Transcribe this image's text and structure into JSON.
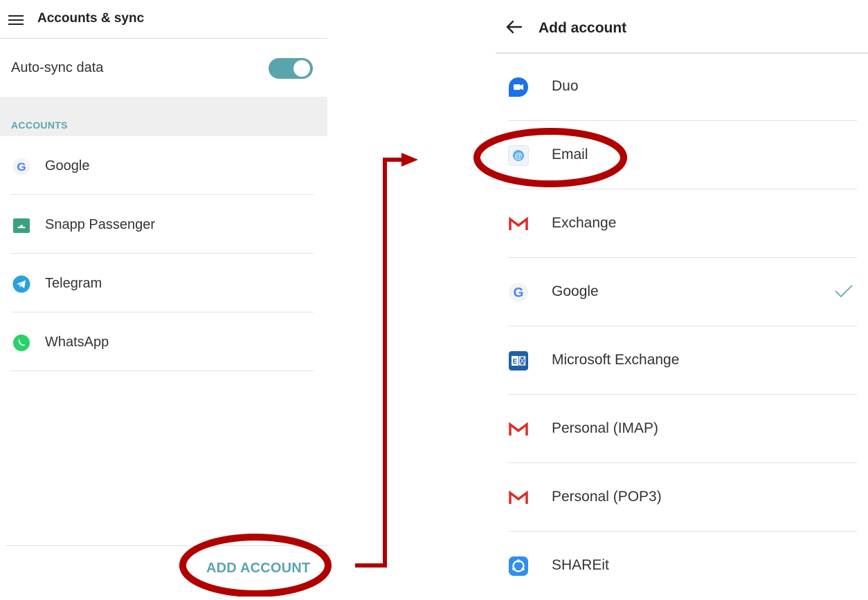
{
  "left_screen": {
    "title": "Accounts & sync",
    "auto_sync": {
      "label": "Auto-sync data",
      "enabled": true
    },
    "section_label": "ACCOUNTS",
    "accounts": [
      {
        "label": "Google",
        "icon": "google-icon"
      },
      {
        "label": "Snapp Passenger",
        "icon": "snapp-icon"
      },
      {
        "label": "Telegram",
        "icon": "telegram-icon"
      },
      {
        "label": "WhatsApp",
        "icon": "whatsapp-icon"
      }
    ],
    "add_account_label": "ADD ACCOUNT"
  },
  "right_screen": {
    "title": "Add account",
    "items": [
      {
        "label": "Duo",
        "icon": "duo-icon",
        "checked": false
      },
      {
        "label": "Email",
        "icon": "email-icon",
        "checked": false,
        "highlighted": true
      },
      {
        "label": "Exchange",
        "icon": "gmail-icon",
        "checked": false
      },
      {
        "label": "Google",
        "icon": "google-icon",
        "checked": true
      },
      {
        "label": "Microsoft Exchange",
        "icon": "outlook-exchange-icon",
        "checked": false
      },
      {
        "label": "Personal (IMAP)",
        "icon": "gmail-icon",
        "checked": false
      },
      {
        "label": "Personal (POP3)",
        "icon": "gmail-icon",
        "checked": false
      },
      {
        "label": "SHAREit",
        "icon": "shareit-icon",
        "checked": false
      }
    ]
  },
  "colors": {
    "accent_teal": "#5aa4ae",
    "annotation_red": "#b00000",
    "section_bg": "#efefef",
    "divider": "#e1e1e1"
  }
}
